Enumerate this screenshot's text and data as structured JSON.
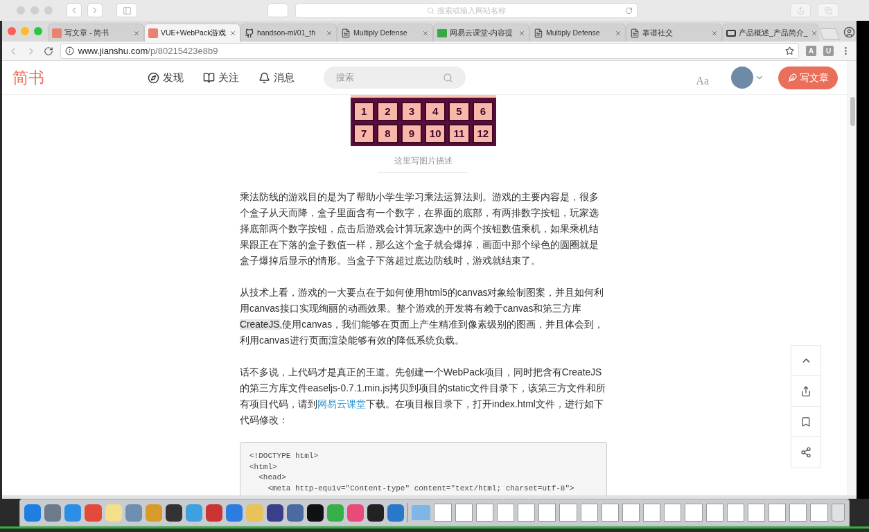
{
  "back_window": {
    "search_placeholder": "搜索或输入网站名称"
  },
  "tabs": [
    {
      "title": "写文章 - 简书",
      "kind": "jianshu",
      "selected": false
    },
    {
      "title": "VUE+WebPack游戏",
      "kind": "jianshu",
      "selected": true
    },
    {
      "title": "handson-ml/01_th",
      "kind": "github",
      "selected": false
    },
    {
      "title": "Multiply Defense",
      "kind": "doc",
      "selected": false
    },
    {
      "title": "网易云课堂-内容提",
      "kind": "green",
      "selected": false
    },
    {
      "title": "Multiply Defense",
      "kind": "doc",
      "selected": false
    },
    {
      "title": "靠谱社交",
      "kind": "doc",
      "selected": false
    },
    {
      "title": "产品概述_产品简介_",
      "kind": "bracket",
      "selected": false
    }
  ],
  "address": {
    "host": "www.jianshu.com",
    "path": "/p/80215423e8b9"
  },
  "extensions": [
    "A",
    "U"
  ],
  "site_header": {
    "logo": "简书",
    "nav": [
      {
        "label": "发现",
        "kind": "compass"
      },
      {
        "label": "关注",
        "kind": "book"
      },
      {
        "label": "消息",
        "kind": "bell"
      }
    ],
    "search_placeholder": "搜索",
    "font_button": "Aa",
    "write_button": "写文章"
  },
  "article": {
    "image_tiles": [
      "1",
      "2",
      "3",
      "4",
      "5",
      "6",
      "7",
      "8",
      "9",
      "10",
      "11",
      "12"
    ],
    "caption": "这里写图片描述",
    "paragraphs": [
      [
        {
          "kind": "text",
          "text": "乘法防线的游戏目的是为了帮助小学生学习乘法运算法则。游戏的主要内容是，很多个盒子从天而降，盒子里面含有一个数字，在界面的底部，有两排数字按钮，玩家选择底部两个数字按钮，点击后游戏会计算玩家选中的两个按钮数值乘机，如果乘机结果跟正在下落的盒子数值一样，那么这个盒子就会爆掉，画面中那个绿色的圆圈就是盒子爆掉后显示的情形。当盒子下落超过底边防线时，游戏就结束了。"
        }
      ],
      [
        {
          "kind": "text",
          "text": "从技术上看，游戏的一大要点在于如何使用html5的canvas对象绘制图案，并且如何利用canvas接口实现绚丽的动画效果。整个游戏的开发将有赖于canvas和第三方库"
        },
        {
          "kind": "highlight",
          "text": "CreateJS"
        },
        {
          "kind": "text",
          "text": ",使用canvas，我们能够在页面上产生精准到像素级别的图画，并且体会到，利用canvas进行页面渲染能够有效的降低系统负载。"
        }
      ],
      [
        {
          "kind": "text",
          "text": "话不多说，上代码才是真正的王道。先创建一个WebPack项目，同时把含有CreateJS的第三方库文件easeljs-0.7.1.min.js拷贝到项目的static文件目录下，该第三方文件和所有项目代码，请到"
        },
        {
          "kind": "link",
          "text": "网易云课堂"
        },
        {
          "kind": "text",
          "text": "下载。在项目根目录下，打开index.html文件，进行如下代码修改："
        }
      ]
    ],
    "code_lines": [
      "<!DOCTYPE html>",
      "<html>",
      "  <head>",
      "    <meta http-equiv=\"Content-type\" content=\"text/html; charset=utf-8\">"
    ]
  }
}
